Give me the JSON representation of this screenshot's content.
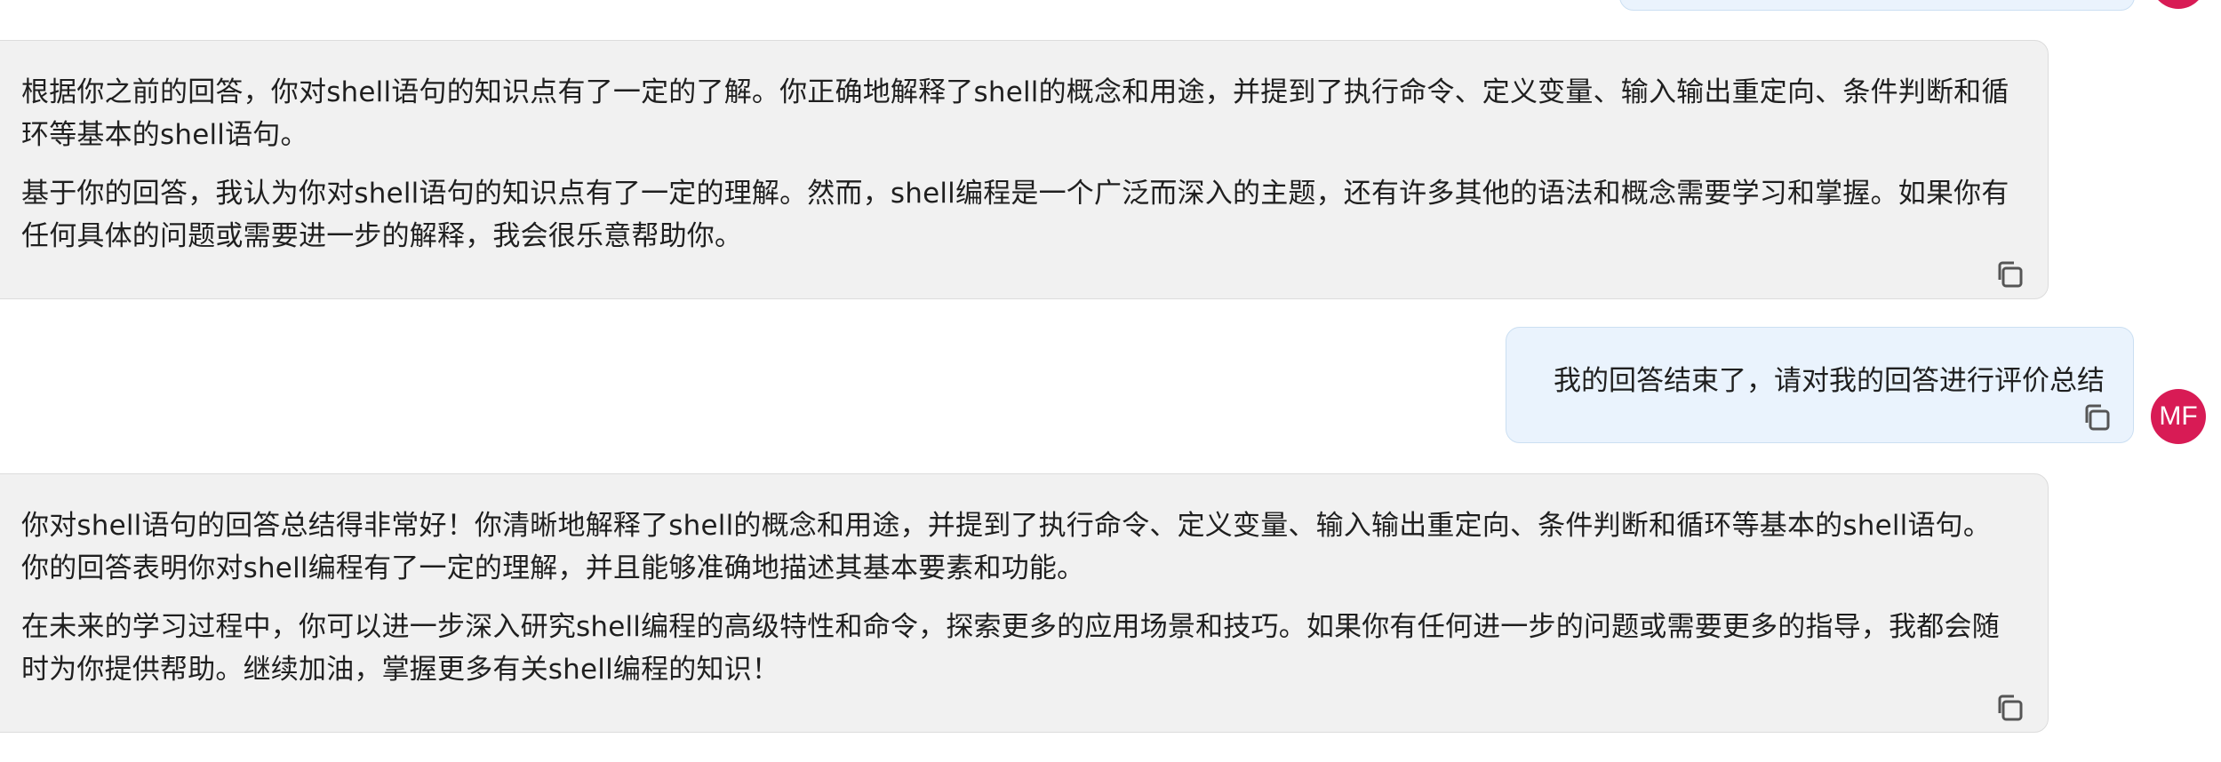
{
  "colors": {
    "bot_bubble_bg": "#f1f1f1",
    "user_bubble_bg": "#eaf3fd",
    "avatar_bg": "#d81b55"
  },
  "icons": {
    "copy": "copy-icon"
  },
  "user": {
    "avatar_initials": "MF"
  },
  "messages": [
    {
      "role": "assistant",
      "paragraphs": [
        "根据你之前的回答，你对shell语句的知识点有了一定的了解。你正确地解释了shell的概念和用途，并提到了执行命令、定义变量、输入输出重定向、条件判断和循环等基本的shell语句。",
        "基于你的回答，我认为你对shell语句的知识点有了一定的理解。然而，shell编程是一个广泛而深入的主题，还有许多其他的语法和概念需要学习和掌握。如果你有任何具体的问题或需要进一步的解释，我会很乐意帮助你。"
      ]
    },
    {
      "role": "user",
      "text": "我的回答结束了，请对我的回答进行评价总结"
    },
    {
      "role": "assistant",
      "paragraphs": [
        "你对shell语句的回答总结得非常好！你清晰地解释了shell的概念和用途，并提到了执行命令、定义变量、输入输出重定向、条件判断和循环等基本的shell语句。你的回答表明你对shell编程有了一定的理解，并且能够准确地描述其基本要素和功能。",
        "在未来的学习过程中，你可以进一步深入研究shell编程的高级特性和命令，探索更多的应用场景和技巧。如果你有任何进一步的问题或需要更多的指导，我都会随时为你提供帮助。继续加油，掌握更多有关shell编程的知识！"
      ]
    }
  ]
}
